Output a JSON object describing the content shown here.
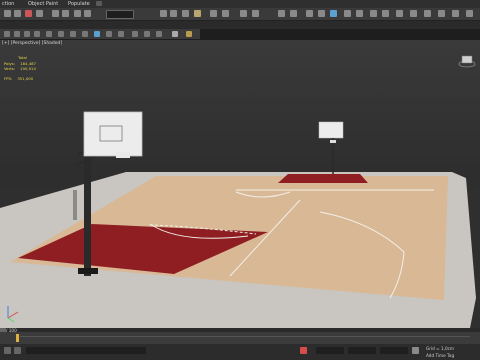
{
  "app": {
    "menu": [
      "ction",
      "Object Paint",
      "Populate"
    ]
  },
  "viewport": {
    "label": "[+] [Perspective] [Shaded]",
    "stats": {
      "header": "Total",
      "polys_label": "Polys:",
      "polys_value": "184,487",
      "verts_label": "Verts:",
      "verts_value": "100,914",
      "fps_label": "FPS:",
      "fps_value": "351,000"
    }
  },
  "timeline": {
    "frame_counter": "0 / 100"
  },
  "status": {
    "grid": "Grid = 1,0cm",
    "add_time_tag": "Add Time Tag"
  },
  "colors": {
    "court_wood": "#d9b896",
    "paint_red": "#8e1e22",
    "apron": "#c9c6c1",
    "floor_grey": "#7a7874",
    "stats_yellow": "#e8d84a"
  }
}
